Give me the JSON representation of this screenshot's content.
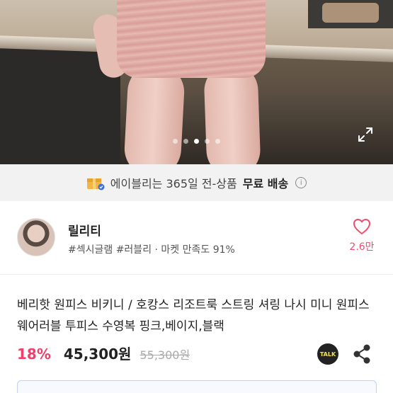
{
  "hero": {
    "slide_count": 5,
    "active_slide": 3
  },
  "banner": {
    "prefix": "에이블리는 365일 전-상품",
    "highlight": "무료 배송",
    "info_icon": "i"
  },
  "seller": {
    "name": "릴리티",
    "meta": "#섹시글램 #러블리 · 마켓 만족도 91%",
    "like_count": "2.6만"
  },
  "product": {
    "title": "베리핫 원피스 비키니 / 호캉스 리조트룩 스트링 셔링 나시 미니 원피스 웨어러블 투피스 수영복 핑크,베이지,블랙",
    "discount": "18%",
    "price": "45,300원",
    "original_price": "55,300원",
    "talk_label": "TALK"
  },
  "colors": {
    "accent_pink": "#ef3f6a",
    "like_pink": "#ef4d6f",
    "banner_bg": "#f2f2f2"
  }
}
